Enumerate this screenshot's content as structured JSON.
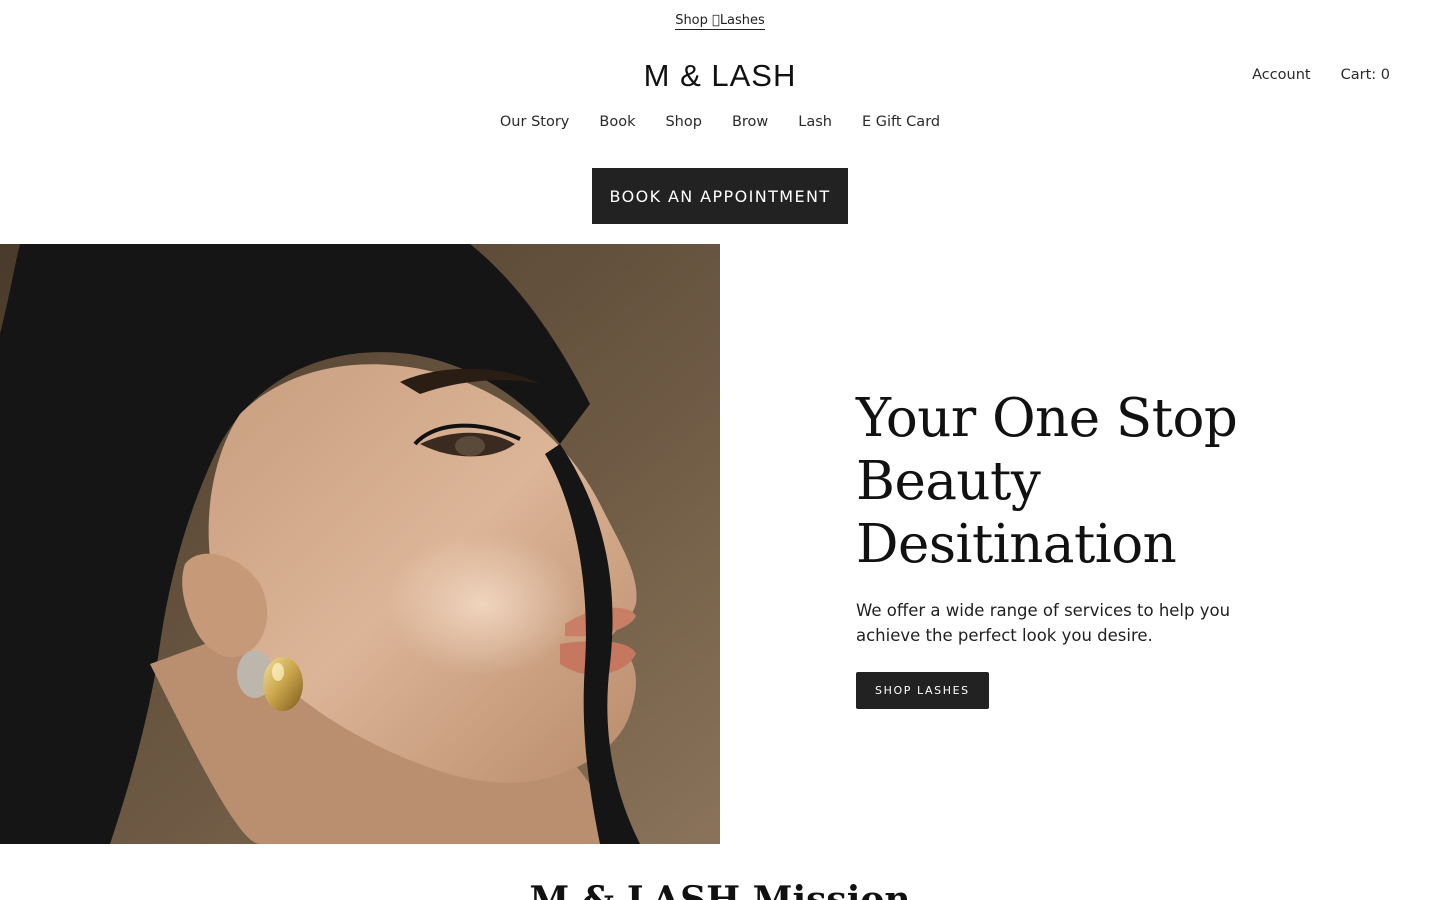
{
  "announcement": {
    "link_label": "Shop \u0000Lashes"
  },
  "header": {
    "logo_text": "M & LASH",
    "account_label": "Account",
    "cart_label": "Cart: 0"
  },
  "nav": {
    "items": [
      "Our Story",
      "Book",
      "Shop",
      "Brow",
      "Lash",
      "E Gift Card"
    ]
  },
  "book_button": {
    "label": "BOOK AN APPOINTMENT"
  },
  "hero": {
    "title": "Your One Stop Beauty Desitination",
    "text": "We offer a wide range of services to help you achieve the perfect look you desire.",
    "button_label": "SHOP LASHES"
  },
  "mission": {
    "title": "M & LASH Mission"
  },
  "colors": {
    "primary_button": "#222222",
    "text": "#1f1f1f",
    "background": "#ffffff"
  }
}
